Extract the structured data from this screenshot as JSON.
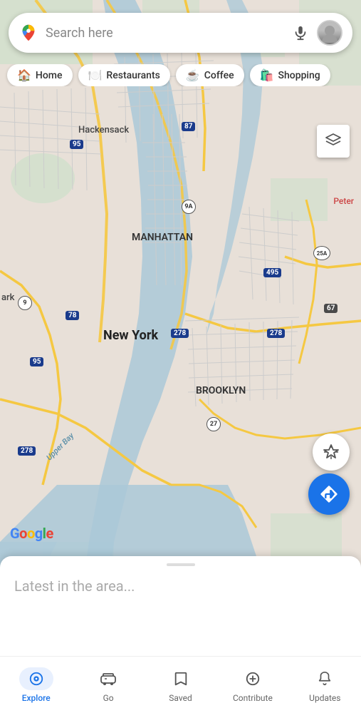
{
  "search": {
    "placeholder": "Search here"
  },
  "chips": [
    {
      "id": "home",
      "label": "Home",
      "icon": "🏠"
    },
    {
      "id": "restaurants",
      "label": "Restaurants",
      "icon": "🍽️"
    },
    {
      "id": "coffee",
      "label": "Coffee",
      "icon": "☕"
    },
    {
      "id": "shopping",
      "label": "Shopping",
      "icon": "🛍️"
    }
  ],
  "map": {
    "city_label": "New York",
    "manhattan_label": "MANHATTAN",
    "brooklyn_label": "BROOKLYN",
    "hackensack_label": "Hackensack",
    "upper_bay_label": "Upper Bay",
    "peter_label": "Peter",
    "park_label": "ark"
  },
  "bottom_sheet": {
    "latest_text": "Latest in the area..."
  },
  "nav": {
    "items": [
      {
        "id": "explore",
        "label": "Explore",
        "icon": "📍",
        "active": true
      },
      {
        "id": "go",
        "label": "Go",
        "icon": "🚗",
        "active": false
      },
      {
        "id": "saved",
        "label": "Saved",
        "icon": "🔖",
        "active": false
      },
      {
        "id": "contribute",
        "label": "Contribute",
        "icon": "➕",
        "active": false
      },
      {
        "id": "updates",
        "label": "Updates",
        "icon": "🔔",
        "active": false
      }
    ]
  },
  "google_logo": "Google"
}
